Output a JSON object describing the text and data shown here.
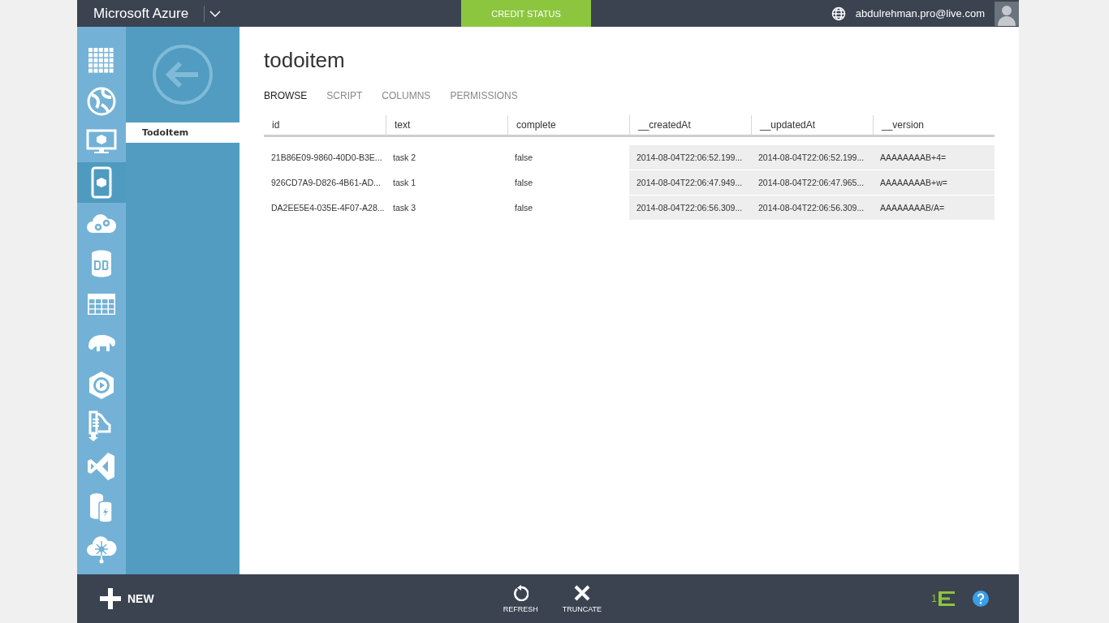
{
  "header": {
    "brand": "Microsoft Azure",
    "credit_button": "CREDIT STATUS",
    "user_email": "abdulrehman.pro@live.com"
  },
  "rail": [
    {
      "selected": false
    },
    {
      "selected": false
    },
    {
      "selected": false
    },
    {
      "selected": true
    },
    {
      "selected": false
    },
    {
      "selected": false
    },
    {
      "selected": false
    },
    {
      "selected": false
    },
    {
      "selected": false
    },
    {
      "selected": false
    },
    {
      "selected": false
    },
    {
      "selected": false
    },
    {
      "selected": false
    }
  ],
  "nav": {
    "items": [
      {
        "label": "TodoItem",
        "selected": true
      }
    ]
  },
  "page": {
    "title": "todoitem",
    "tabs": [
      {
        "label": "BROWSE",
        "selected": true
      },
      {
        "label": "SCRIPT",
        "selected": false
      },
      {
        "label": "COLUMNS",
        "selected": false
      },
      {
        "label": "PERMISSIONS",
        "selected": false
      }
    ],
    "table": {
      "columns": [
        {
          "label": "id",
          "shaded": false
        },
        {
          "label": "text",
          "shaded": false
        },
        {
          "label": "complete",
          "shaded": false
        },
        {
          "label": "__createdAt",
          "shaded": true
        },
        {
          "label": "__updatedAt",
          "shaded": true
        },
        {
          "label": "__version",
          "shaded": true
        }
      ],
      "rows": [
        [
          "21B86E09-9860-40D0-B3E...",
          "task 2",
          "false",
          "2014-08-04T22:06:52.199...",
          "2014-08-04T22:06:52.199...",
          "AAAAAAAAB+4="
        ],
        [
          "926CD7A9-D826-4B61-AD...",
          "task 1",
          "false",
          "2014-08-04T22:06:47.949...",
          "2014-08-04T22:06:47.965...",
          "AAAAAAAAB+w="
        ],
        [
          "DA2EE5E4-035E-4F07-A28...",
          "task 3",
          "false",
          "2014-08-04T22:06:56.309...",
          "2014-08-04T22:06:56.309...",
          "AAAAAAAAB/A="
        ]
      ]
    }
  },
  "command_bar": {
    "new_button": "NEW",
    "actions": [
      {
        "label": "REFRESH",
        "kind": "refresh"
      },
      {
        "label": "TRUNCATE",
        "kind": "truncate"
      }
    ],
    "notification_count": "1"
  }
}
